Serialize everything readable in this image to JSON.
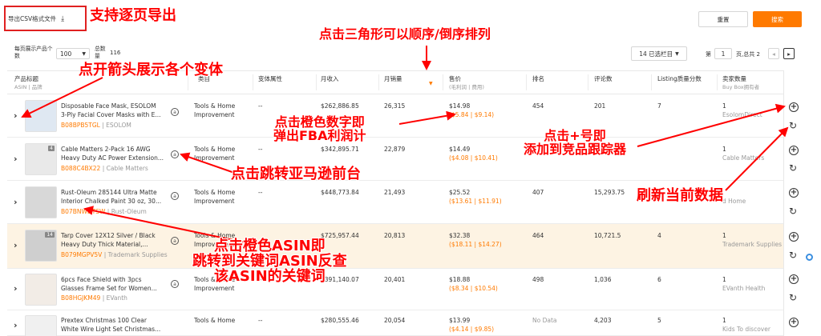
{
  "toolbar": {
    "export_label": "导出CSV格式文件",
    "reset_label": "重置",
    "search_label": "搜索"
  },
  "pager": {
    "per_page_label": "每页展示产品个数",
    "per_page_value": "100",
    "total_label": "总数量",
    "total_value": "116",
    "selected_cols": "14 已选栏目",
    "page_label": "第",
    "page_value": "1",
    "page_total": "页,总共 2"
  },
  "columns": [
    {
      "title": "产品标题",
      "sub": "ASIN | 品牌"
    },
    {
      "title": "类目",
      "sub": ""
    },
    {
      "title": "变体属性",
      "sub": ""
    },
    {
      "title": "月收入",
      "sub": ""
    },
    {
      "title": "月销量",
      "sub": ""
    },
    {
      "title": "售价",
      "sub": "(毛利润 | 费用)"
    },
    {
      "title": "排名",
      "sub": ""
    },
    {
      "title": "评论数",
      "sub": ""
    },
    {
      "title": "Listing质量分数",
      "sub": ""
    },
    {
      "title": "卖家数量",
      "sub": "Buy Box拥有者"
    }
  ],
  "rows": [
    {
      "count": "",
      "title1": "Disposable Face Mask, ESOLOM",
      "title2": "3-Ply Facial Cover Masks with E...",
      "asin": "B08BPB5TGL",
      "brand": "ESOLOM",
      "cat1": "Tools & Home",
      "cat2": "Improvement",
      "variant": "--",
      "revenue": "$262,886.85",
      "sales": "26,315",
      "price": "$14.98",
      "fees": "($5.84 | $9.14)",
      "rank": "454",
      "reviews": "201",
      "lqs": "7",
      "sellers": "1",
      "buybox": "EsolomDirect"
    },
    {
      "count": "4",
      "title1": "Cable Matters 2-Pack 16 AWG",
      "title2": "Heavy Duty AC Power Extension...",
      "asin": "B088C4BX22",
      "brand": "Cable Matters",
      "cat1": "Tools & Home",
      "cat2": "Improvement",
      "variant": "--",
      "revenue": "$342,895.71",
      "sales": "22,879",
      "price": "$14.49",
      "fees": "($4.08 | $10.41)",
      "rank": "",
      "reviews": "",
      "lqs": "",
      "sellers": "1",
      "buybox": "Cable Matters"
    },
    {
      "count": "",
      "title1": "Rust-Oleum 285144 Ultra Matte",
      "title2": "Interior Chalked Paint 30 oz, 30...",
      "asin": "B07BNWDTSW",
      "brand": "Rust-Oleum",
      "cat1": "Tools & Home",
      "cat2": "Improvement",
      "variant": "--",
      "revenue": "$448,773.84",
      "sales": "21,493",
      "price": "$25.52",
      "fees": "($13.61 | $11.91)",
      "rank": "407",
      "reviews": "15,293.75",
      "lqs": "",
      "sellers": "",
      "buybox": "d Home"
    },
    {
      "count": "14",
      "title1": "Tarp Cover 12X12 Silver / Black",
      "title2": "Heavy Duty Thick Material,...",
      "asin": "B079MGPV5V",
      "brand": "Trademark Supplies",
      "cat1": "Tools & Home",
      "cat2": "Improvement",
      "variant": "",
      "revenue": "$725,957.44",
      "sales": "20,813",
      "price": "$32.38",
      "fees": "($18.11 | $14.27)",
      "rank": "464",
      "reviews": "10,721.5",
      "lqs": "4",
      "sellers": "1",
      "buybox": "Trademark Supplies"
    },
    {
      "count": "",
      "title1": "6pcs Face Shield with 3pcs",
      "title2": "Glasses Frame Set for Women...",
      "asin": "B08HGJKM49",
      "brand": "EVanth",
      "cat1": "Tools & Home",
      "cat2": "Improvement",
      "variant": "--",
      "revenue": "$391,140.07",
      "sales": "20,401",
      "price": "$18.88",
      "fees": "($8.34 | $10.54)",
      "rank": "498",
      "reviews": "1,036",
      "lqs": "6",
      "sellers": "1",
      "buybox": "EVanth Health"
    },
    {
      "count": "",
      "title1": "Prextex Christmas 100 Clear",
      "title2": "White Wire Light Set Christmas...",
      "asin": "",
      "brand": "",
      "cat1": "Tools & Home",
      "cat2": "",
      "variant": "--",
      "revenue": "$280,555.46",
      "sales": "20,054",
      "price": "$13.99",
      "fees": "($4.14 | $9.85)",
      "rank": "No Data",
      "reviews": "4,203",
      "lqs": "5",
      "sellers": "1",
      "buybox": "Kids To discover"
    }
  ],
  "annotations": {
    "export": "支持逐页导出",
    "sort": "点击三角形可以顺序/倒序排列",
    "variants": "点开箭头展示各个变体",
    "fba1": "点击橙色数字即",
    "fba2": "弹出FBA利润计",
    "tracker1": "点击+号即",
    "tracker2": "添加到竞品跟踪器",
    "amazon": "点击跳转亚马逊前台",
    "refresh": "刷新当前数据",
    "asin1": "点击橙色ASIN即",
    "asin2": "跳转到关键词ASIN反查",
    "asin3": "该ASIN的关键词"
  },
  "colors": {
    "accent": "#ff7a00",
    "annotation": "#ff0000"
  }
}
